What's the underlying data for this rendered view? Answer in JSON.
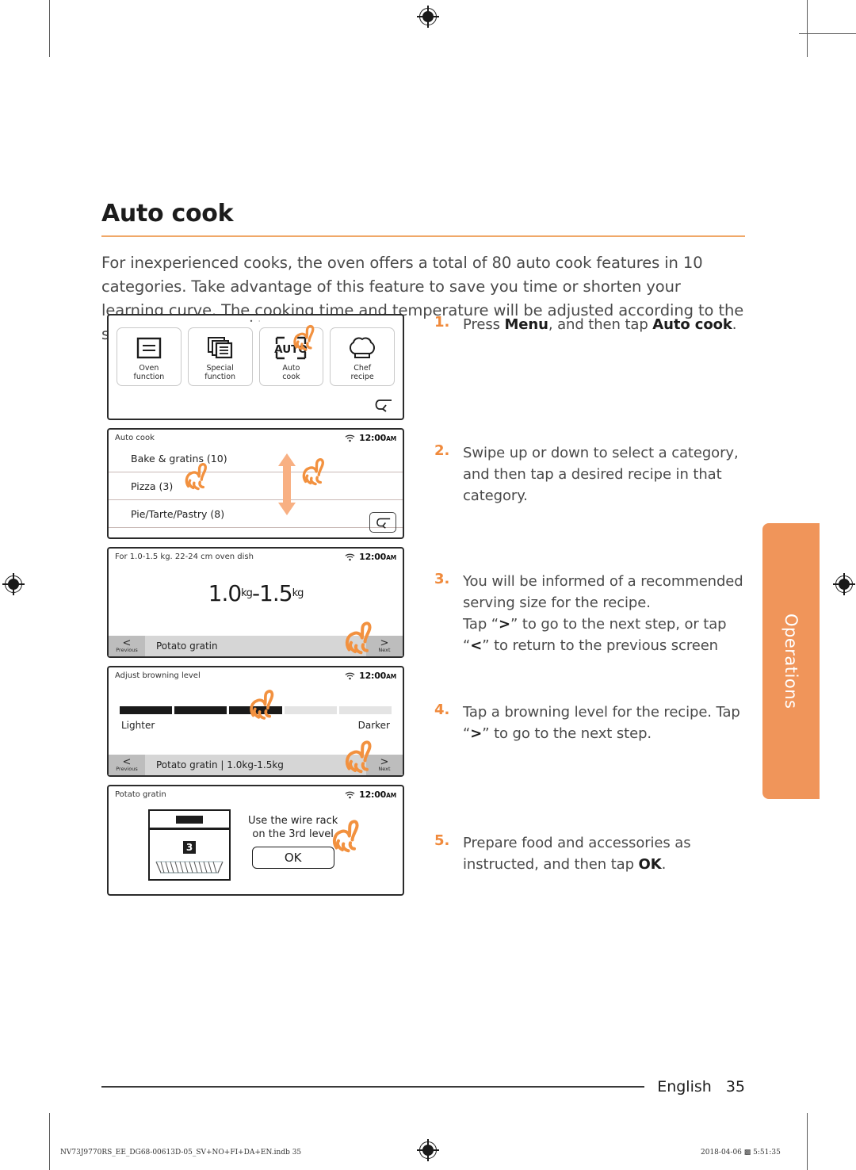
{
  "document": {
    "heading": "Auto cook",
    "intro": "For inexperienced cooks, the oven offers a total of 80 auto cook features in 10 categories. Take advantage of this feature to save you time or shorten your learning curve. The cooking time and temperature will be adjusted according to the selected recipe.",
    "accent_color": "#f0a868",
    "step_number_color": "#f08a3c"
  },
  "side_tab": {
    "label": "Operations",
    "color": "#f0955a"
  },
  "panels": {
    "menu": {
      "buttons": [
        {
          "label_line1": "Oven",
          "label_line2": "function",
          "icon": "oven-function-icon"
        },
        {
          "label_line1": "Special",
          "label_line2": "function",
          "icon": "special-function-icon"
        },
        {
          "label_line1": "Auto",
          "label_line2": "cook",
          "icon": "auto-cook-icon",
          "icon_text": "AUTO"
        },
        {
          "label_line1": "Chef",
          "label_line2": "recipe",
          "icon": "chef-hat-icon"
        }
      ],
      "back_icon": "back-arrow-icon"
    },
    "category_list": {
      "title": "Auto cook",
      "clock": "12:00",
      "clock_ampm": "AM",
      "wifi_icon": "wifi-icon",
      "rows": [
        "Bake & gratins (10)",
        "Pizza (3)",
        "Pie/Tarte/Pastry (8)"
      ],
      "back_icon": "back-arrow-icon",
      "swipe_icon": "swipe-up-down-arrow-icon"
    },
    "serving_size": {
      "title": "For 1.0-1.5 kg. 22-24 cm oven dish",
      "clock": "12:00",
      "clock_ampm": "AM",
      "value_min": "1.0",
      "value_min_unit": "kg",
      "dash": "-",
      "value_max": "1.5",
      "value_max_unit": "kg",
      "nav": {
        "prev_chevron": "<",
        "prev_caption": "Previous",
        "next_chevron": ">",
        "next_caption": "Next",
        "title": "Potato gratin"
      }
    },
    "browning": {
      "title": "Adjust browning level",
      "clock": "12:00",
      "clock_ampm": "AM",
      "segments_total": 5,
      "segments_filled": 3,
      "label_left": "Lighter",
      "label_right": "Darker",
      "nav": {
        "prev_chevron": "<",
        "prev_caption": "Previous",
        "next_chevron": ">",
        "next_caption": "Next",
        "title": "Potato gratin  |  1.0kg-1.5kg"
      }
    },
    "wire_rack": {
      "title": "Potato gratin",
      "clock": "12:00",
      "clock_ampm": "AM",
      "level_number": "3",
      "message_line1": "Use the wire rack",
      "message_line2": "on the 3rd level",
      "ok_label": "OK"
    }
  },
  "steps": [
    {
      "num": "1.",
      "html": "Press <b>Menu</b>, and then tap <b>Auto cook</b>."
    },
    {
      "num": "2.",
      "html": "Swipe up or down to select a category, and then tap a desired recipe in that category."
    },
    {
      "num": "3.",
      "html": "You will be informed of a recommended serving size for the recipe.<br>Tap “<b>&gt;</b>” to go to the next step, or tap “<b>&lt;</b>” to return to the previous screen"
    },
    {
      "num": "4.",
      "html": "Tap a browning level for the recipe. Tap “<b>&gt;</b>” to go to the next step."
    },
    {
      "num": "5.",
      "html": "Prepare food and accessories as instructed, and then tap <b>OK</b>."
    }
  ],
  "footer": {
    "language": "English",
    "page_number": "35"
  },
  "print_marks": {
    "filename": "NV73J9770RS_EE_DG68-00613D-05_SV+NO+FI+DA+EN.indb   35",
    "timestamp": "2018-04-06   ▩ 5:51:35"
  }
}
